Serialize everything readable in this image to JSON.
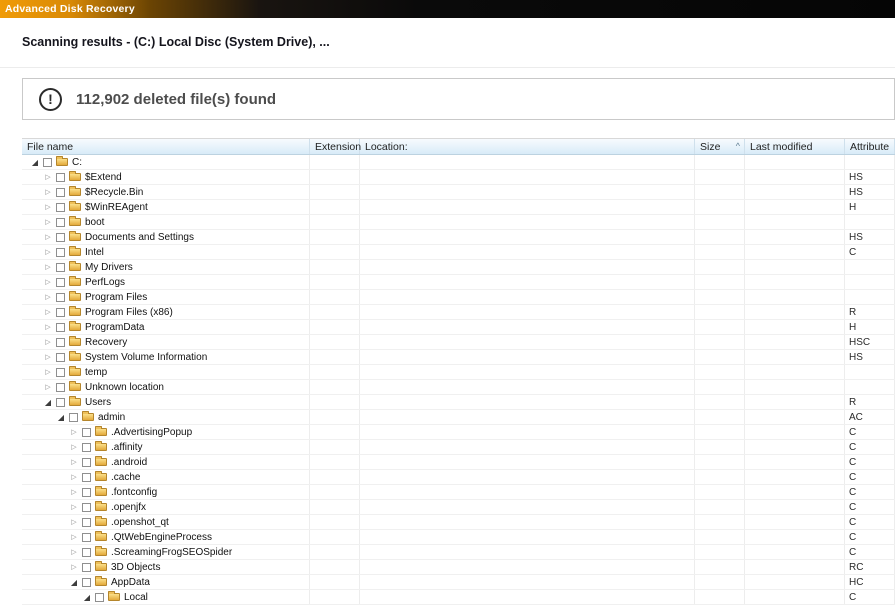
{
  "titlebar": {
    "title": "Advanced Disk Recovery"
  },
  "page": {
    "heading": "Scanning results - (C:) Local Disc (System Drive), ..."
  },
  "alert": {
    "icon_glyph": "!",
    "message": "112,902 deleted file(s) found"
  },
  "table": {
    "columns": [
      "File name",
      "Extension",
      "Location:",
      "Size",
      "Last modified",
      "Attribute"
    ],
    "sort": {
      "column": "Size",
      "indicator": "^"
    },
    "rows": [
      {
        "name": "C:",
        "level": 0,
        "expanded": true,
        "attribute": ""
      },
      {
        "name": "$Extend",
        "level": 1,
        "expanded": false,
        "attribute": "HS"
      },
      {
        "name": "$Recycle.Bin",
        "level": 1,
        "expanded": false,
        "attribute": "HS"
      },
      {
        "name": "$WinREAgent",
        "level": 1,
        "expanded": false,
        "attribute": "H"
      },
      {
        "name": "boot",
        "level": 1,
        "expanded": false,
        "attribute": ""
      },
      {
        "name": "Documents and Settings",
        "level": 1,
        "expanded": false,
        "attribute": "HS"
      },
      {
        "name": "Intel",
        "level": 1,
        "expanded": false,
        "attribute": "C"
      },
      {
        "name": "My Drivers",
        "level": 1,
        "expanded": false,
        "attribute": ""
      },
      {
        "name": "PerfLogs",
        "level": 1,
        "expanded": false,
        "attribute": ""
      },
      {
        "name": "Program Files",
        "level": 1,
        "expanded": false,
        "attribute": ""
      },
      {
        "name": "Program Files (x86)",
        "level": 1,
        "expanded": false,
        "attribute": "R"
      },
      {
        "name": "ProgramData",
        "level": 1,
        "expanded": false,
        "attribute": "H"
      },
      {
        "name": "Recovery",
        "level": 1,
        "expanded": false,
        "attribute": "HSC"
      },
      {
        "name": "System Volume Information",
        "level": 1,
        "expanded": false,
        "attribute": "HS"
      },
      {
        "name": "temp",
        "level": 1,
        "expanded": false,
        "attribute": ""
      },
      {
        "name": "Unknown location",
        "level": 1,
        "expanded": false,
        "attribute": ""
      },
      {
        "name": "Users",
        "level": 1,
        "expanded": true,
        "attribute": "R"
      },
      {
        "name": "admin",
        "level": 2,
        "expanded": true,
        "attribute": "AC"
      },
      {
        "name": ".AdvertisingPopup",
        "level": 3,
        "expanded": false,
        "attribute": "C"
      },
      {
        "name": ".affinity",
        "level": 3,
        "expanded": false,
        "attribute": "C"
      },
      {
        "name": ".android",
        "level": 3,
        "expanded": false,
        "attribute": "C"
      },
      {
        "name": ".cache",
        "level": 3,
        "expanded": false,
        "attribute": "C"
      },
      {
        "name": ".fontconfig",
        "level": 3,
        "expanded": false,
        "attribute": "C"
      },
      {
        "name": ".openjfx",
        "level": 3,
        "expanded": false,
        "attribute": "C"
      },
      {
        "name": ".openshot_qt",
        "level": 3,
        "expanded": false,
        "attribute": "C"
      },
      {
        "name": ".QtWebEngineProcess",
        "level": 3,
        "expanded": false,
        "attribute": "C"
      },
      {
        "name": ".ScreamingFrogSEOSpider",
        "level": 3,
        "expanded": false,
        "attribute": "C"
      },
      {
        "name": "3D Objects",
        "level": 3,
        "expanded": false,
        "attribute": "RC"
      },
      {
        "name": "AppData",
        "level": 3,
        "expanded": true,
        "attribute": "HC"
      },
      {
        "name": "Local",
        "level": 4,
        "expanded": true,
        "attribute": "C"
      }
    ]
  },
  "colors": {
    "titlebar_orange": "#f09b07",
    "titlebar_dark": "#0a0a0a",
    "table_header_bg": "#d8ebf8",
    "folder_icon": "#e3aa3c",
    "alert_text": "#4d4d4d"
  }
}
